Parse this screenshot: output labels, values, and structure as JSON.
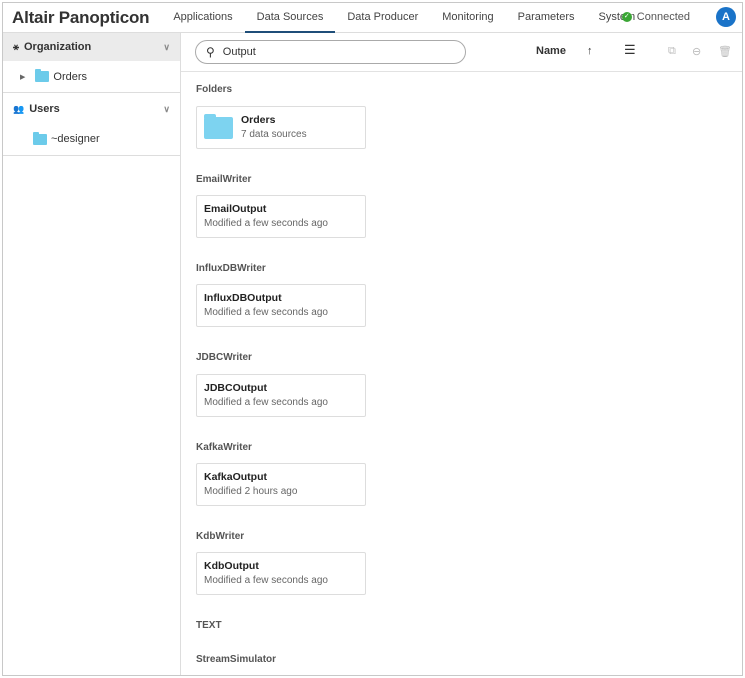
{
  "header": {
    "logo": "Altair Panopticon",
    "nav": [
      "Applications",
      "Data Sources",
      "Data Producer",
      "Monitoring",
      "Parameters",
      "System"
    ],
    "active_tab": "Data Sources",
    "status": "Connected",
    "avatar": "A"
  },
  "sidebar": {
    "organization": {
      "label": "Organization",
      "items": [
        "Orders"
      ]
    },
    "users": {
      "label": "Users",
      "items": [
        "~designer"
      ]
    }
  },
  "toolbar": {
    "search_value": "Output",
    "sort_label": "Name",
    "sort_dir": "↑"
  },
  "content": {
    "folders": {
      "label": "Folders",
      "card": {
        "title": "Orders",
        "subtitle": "7 data sources"
      }
    },
    "sections": [
      {
        "label": "EmailWriter",
        "title": "EmailOutput",
        "subtitle": "Modified a few seconds ago"
      },
      {
        "label": "InfluxDBWriter",
        "title": "InfluxDBOutput",
        "subtitle": "Modified a few seconds ago"
      },
      {
        "label": "JDBCWriter",
        "title": "JDBCOutput",
        "subtitle": "Modified a few seconds ago"
      },
      {
        "label": "KafkaWriter",
        "title": "KafkaOutput",
        "subtitle": "Modified 2 hours ago"
      },
      {
        "label": "KdbWriter",
        "title": "KdbOutput",
        "subtitle": "Modified a few seconds ago"
      }
    ],
    "extra_sections": [
      "TEXT",
      "StreamSimulator"
    ]
  }
}
